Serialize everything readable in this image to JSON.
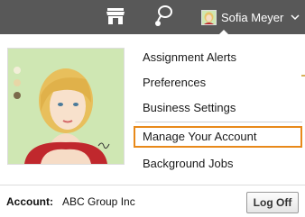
{
  "topbar": {
    "store_icon": "store-icon",
    "chat_icon": "chat-bubble-icon",
    "user_name": "Sofia Meyer",
    "chevron_icon": "chevron-down-icon",
    "background_color": "#585858"
  },
  "menu": {
    "items": [
      {
        "label": "Assignment Alerts"
      },
      {
        "label": "Preferences"
      },
      {
        "label": "Business Settings"
      },
      {
        "label": "Manage Your Account"
      },
      {
        "label": "Background Jobs"
      }
    ],
    "highlight_color": "#e8891a"
  },
  "account": {
    "label": "Account:",
    "name": "ABC Group Inc"
  },
  "logoff": {
    "label": "Log Off"
  }
}
